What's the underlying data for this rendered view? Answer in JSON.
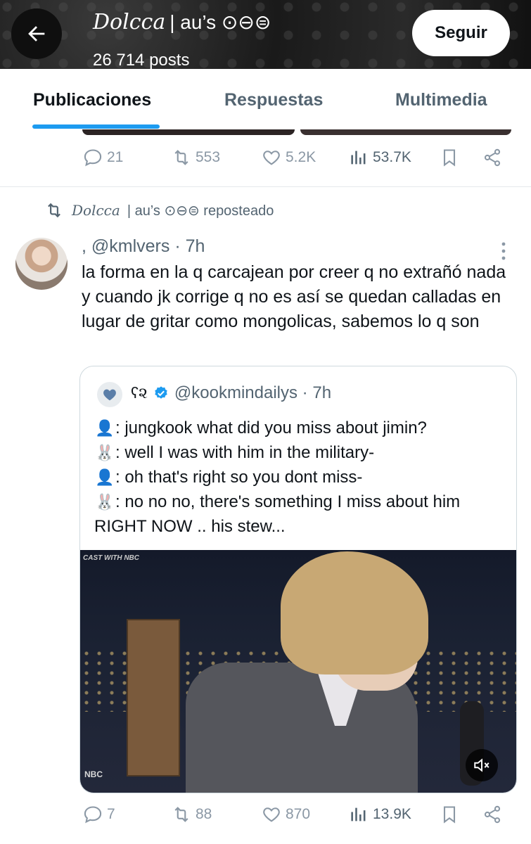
{
  "header": {
    "display_name_script": "Dolcca",
    "display_name_suffix": "| au’s ⊙⊖⊜",
    "posts_count": "26 714 posts",
    "follow_label": "Seguir"
  },
  "tabs": [
    {
      "label": "Publicaciones",
      "active": true
    },
    {
      "label": "Respuestas",
      "active": false
    },
    {
      "label": "Multimedia",
      "active": false
    }
  ],
  "prev_post_actions": {
    "replies": "21",
    "reposts": "553",
    "likes": "5.2K",
    "views": "53.7K"
  },
  "post": {
    "repost_by_script": "Dolcca",
    "repost_by_rest": "| au’s ⊙⊖⊜ reposteado",
    "handle": ", @kmlvers · 7h",
    "text": "la forma en la q carcajean por creer q no extrañó nada y cuando jk corrige q no es así se quedan calladas en lugar de gritar como mongolicas, sabemos lo q son",
    "quote": {
      "name_glyph": "ʕ૨",
      "handle": "@kookmindailys · 7h",
      "lines": [
        {
          "emoji": "👤",
          "text": ": jungkook what did you miss about jimin?"
        },
        {
          "emoji": "🐰",
          "text": ": well I was with him in the military-"
        },
        {
          "emoji": "👤",
          "text": ": oh that's right so you dont miss-"
        },
        {
          "emoji": "🐰",
          "text": ": no no no, there's something I miss about him"
        }
      ],
      "last_line": "RIGHT NOW .. his stew...",
      "video_logo_top": "CAST WITH NBC",
      "video_logo_bottom": "NBC"
    },
    "actions": {
      "replies": "7",
      "reposts": "88",
      "likes": "870",
      "views": "13.9K"
    }
  },
  "colors": {
    "accent": "#1d9bf0",
    "muted_text": "#536471",
    "icon_gray": "#8b98a5",
    "verified": "#1d9bf0"
  }
}
